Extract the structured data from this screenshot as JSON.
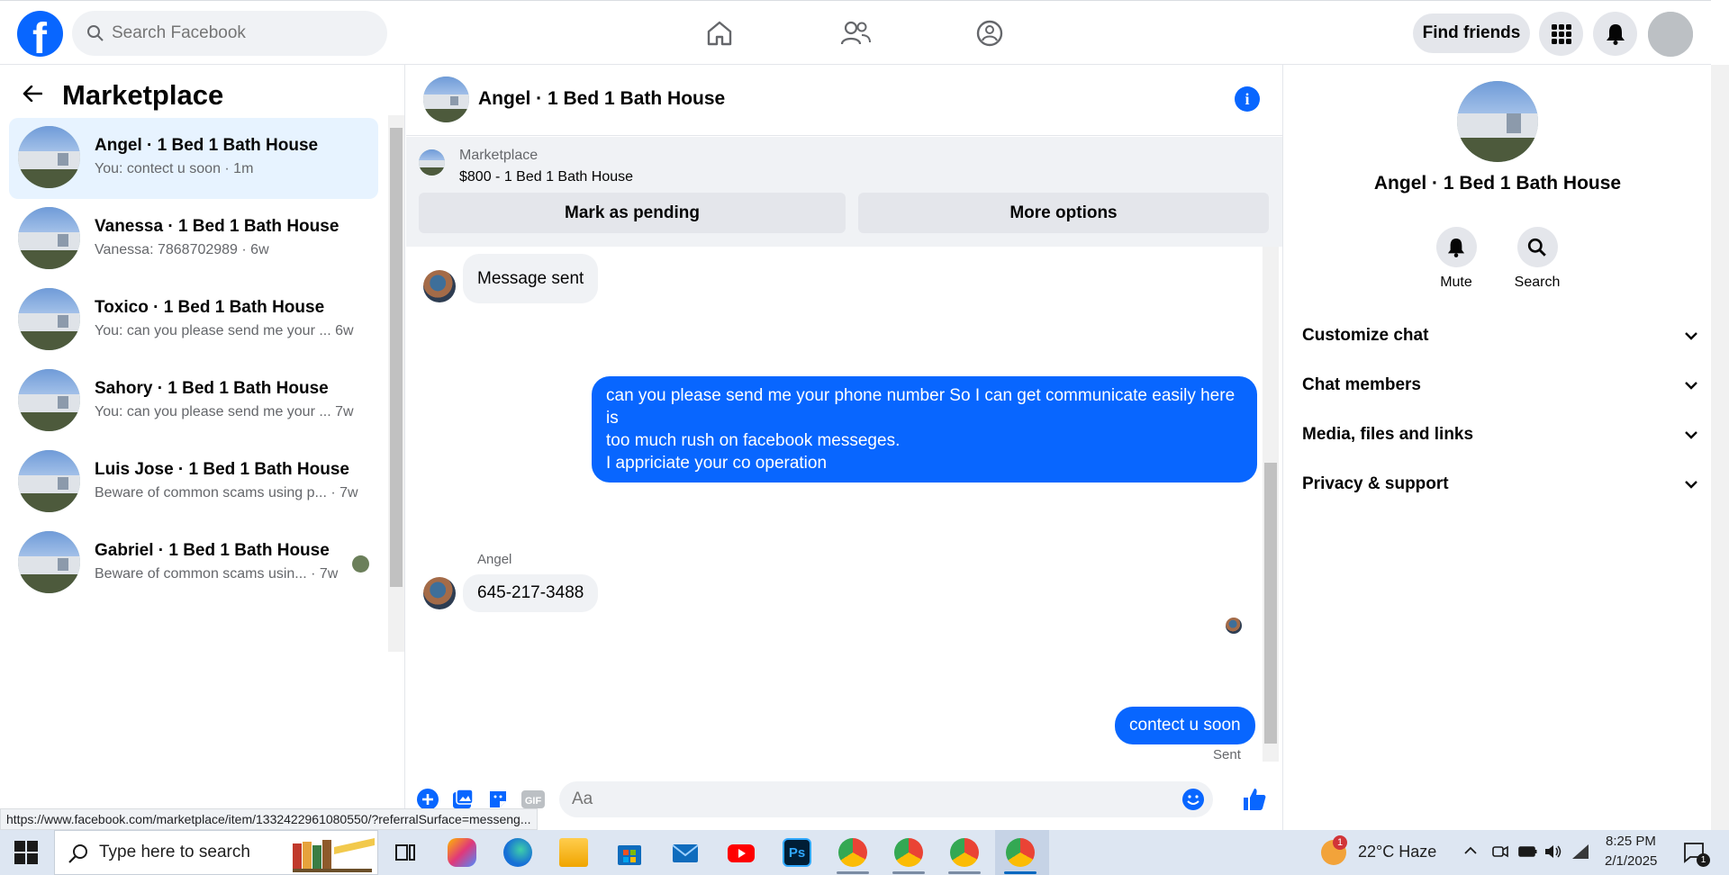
{
  "topbar": {
    "search_placeholder": "Search Facebook",
    "find_friends": "Find friends"
  },
  "sidebar": {
    "title": "Marketplace",
    "conversations": [
      {
        "title": "Angel · 1 Bed 1 Bath House",
        "snippet": "You: contect u soon · 1m"
      },
      {
        "title": "Vanessa · 1 Bed 1 Bath House",
        "snippet": "Vanessa: 7868702989 · 6w"
      },
      {
        "title": "Toxico · 1 Bed 1 Bath House",
        "snippet": "You: can you please send me your ...   6w"
      },
      {
        "title": "Sahory · 1 Bed 1 Bath House",
        "snippet": "You: can you please send me your ...   7w"
      },
      {
        "title": "Luis Jose · 1 Bed 1 Bath House",
        "snippet": "Beware of common scams using p... · 7w"
      },
      {
        "title": "Gabriel · 1 Bed 1 Bath House",
        "snippet": "Beware of common scams usin... · 7w"
      }
    ]
  },
  "chat": {
    "title": "Angel · 1 Bed 1 Bath House",
    "marketplace_label": "Marketplace",
    "listing": "$800 - 1 Bed 1 Bath House",
    "mark_pending": "Mark as pending",
    "more_options": "More options",
    "messages": {
      "msg1": "Message sent",
      "msg2_line1": "can you please send me your phone number So I can get communicate easily here is",
      "msg2_line2": "too much rush on facebook messeges.",
      "msg2_line3": "I appriciate your co operation",
      "sender": "Angel",
      "msg3": "645-217-3488",
      "msg4": "contect u soon",
      "status": "Sent"
    },
    "composer_placeholder": "Aa"
  },
  "details": {
    "name": "Angel · 1 Bed 1 Bath House",
    "mute": "Mute",
    "search": "Search",
    "sections": [
      "Customize chat",
      "Chat members",
      "Media, files and links",
      "Privacy & support"
    ]
  },
  "status_url": "https://www.facebook.com/marketplace/item/1332422961080550/?referralSurface=messeng...",
  "taskbar": {
    "search": "Type here to search",
    "weather": "22°C  Haze",
    "time": "8:25 PM",
    "date": "2/1/2025",
    "notif_count": "1",
    "alert_badge": "1",
    "ps_label": "Ps"
  },
  "colors": {
    "brand": "#0866ff",
    "active_bg": "#e7f3ff",
    "bubble_in": "#f0f2f5"
  }
}
